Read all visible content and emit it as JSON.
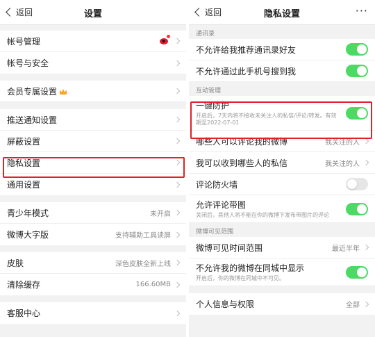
{
  "left": {
    "nav": {
      "back_label": "返回",
      "title": "设置"
    },
    "groups": [
      [
        {
          "label": "帐号管理",
          "value": "",
          "icon": "weibo-avatar-icon"
        },
        {
          "label": "帐号与安全",
          "value": ""
        }
      ],
      [
        {
          "label": "会员专属设置",
          "value": "",
          "icon": "crown-icon"
        }
      ],
      [
        {
          "label": "推送通知设置",
          "value": ""
        },
        {
          "label": "屏蔽设置",
          "value": ""
        },
        {
          "label": "隐私设置",
          "value": ""
        },
        {
          "label": "通用设置",
          "value": ""
        }
      ],
      [
        {
          "label": "青少年模式",
          "value": "未开启"
        },
        {
          "label": "微博大字版",
          "value": "支持辅助工具读屏"
        }
      ],
      [
        {
          "label": "皮肤",
          "value": "深色皮肤全新上线"
        },
        {
          "label": "清除缓存",
          "value": "166.60MB"
        }
      ],
      [
        {
          "label": "客服中心",
          "value": ""
        }
      ]
    ]
  },
  "right": {
    "nav": {
      "back_label": "返回",
      "title": "隐私设置",
      "more": "···"
    },
    "sections": {
      "contacts": {
        "header": "通讯录",
        "rows": [
          {
            "label": "不允许给我推荐通讯录好友",
            "toggle": true
          },
          {
            "label": "不允许通过此手机号搜到我",
            "toggle": true
          }
        ]
      },
      "interaction": {
        "header": "互动管理",
        "one_click": {
          "label": "一键防护",
          "sub": "开启后，7天内将不接收未关注人的私信/评论/转发。有效期至2022-07-01",
          "toggle": true
        },
        "rows": [
          {
            "label": "哪些人可以评论我的微博",
            "value": "我关注的人"
          },
          {
            "label": "我可以收到哪些人的私信",
            "value": "我关注的人"
          }
        ],
        "firewall": {
          "label": "评论防火墙",
          "toggle": false
        },
        "pic_comment": {
          "label": "允许评论带图",
          "sub": "关闭后，其他人将不能在你的微博下发布带图片的评论",
          "toggle": true
        }
      },
      "visibility": {
        "header": "微博可见范围",
        "time_range": {
          "label": "微博可见时间范围",
          "value": "最近半年"
        },
        "city": {
          "label": "不允许我的微博在同城中显示",
          "sub": "开启后，你的微博在同城中不可见。",
          "toggle": true
        }
      },
      "personal": {
        "label": "个人信息与权限",
        "value": "全部"
      }
    }
  },
  "colors": {
    "toggle_on": "#4cd964",
    "highlight": "#e0202a",
    "weibo_red": "#e6162d",
    "crown": "#f5a623"
  }
}
